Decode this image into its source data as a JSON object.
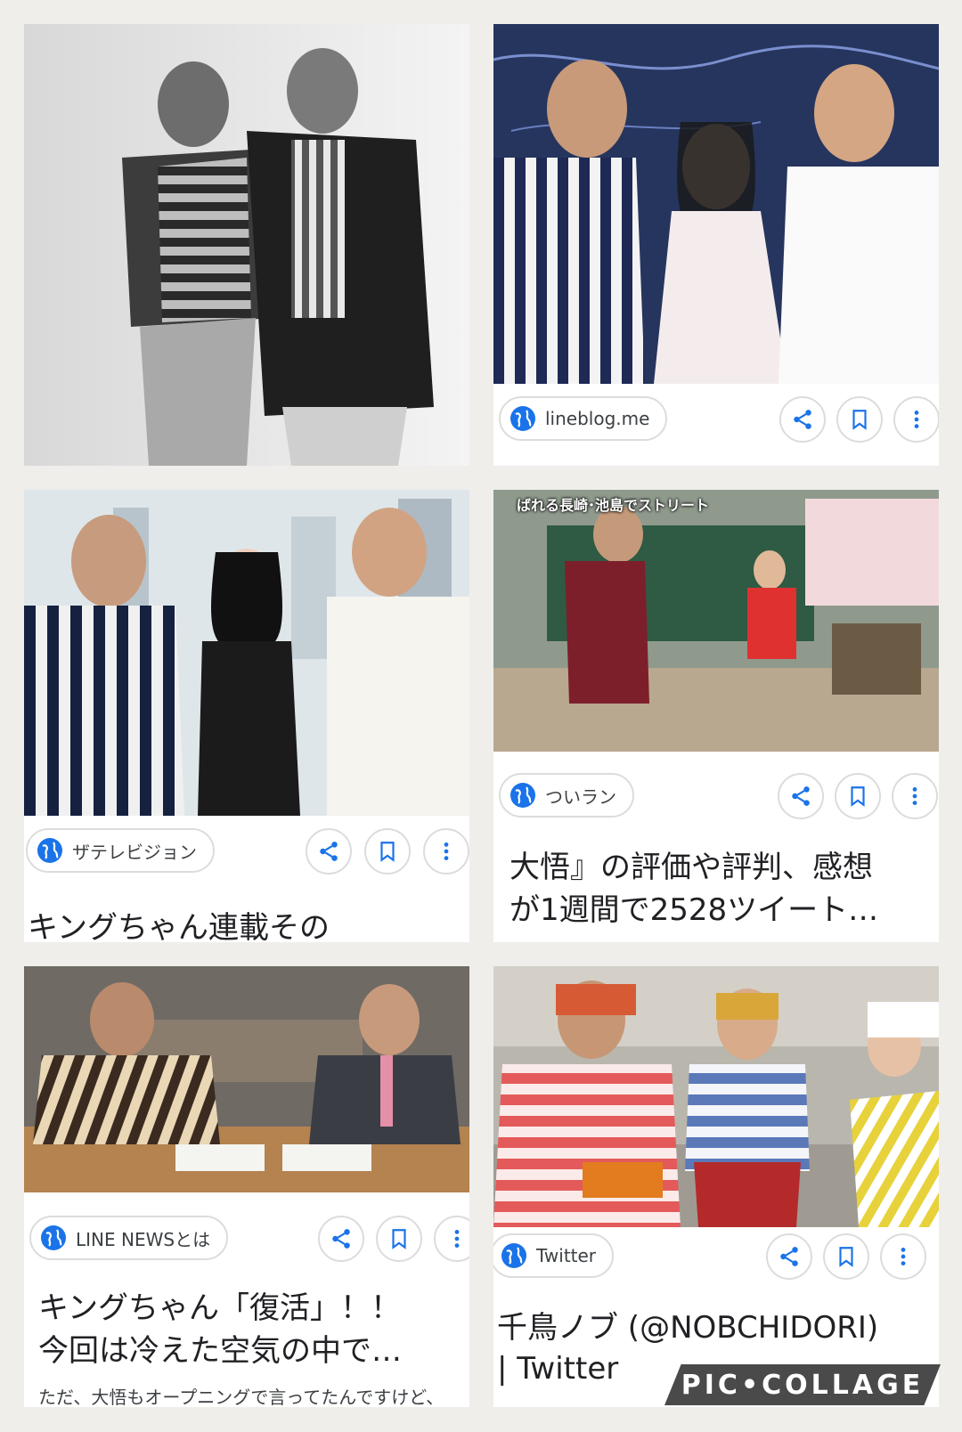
{
  "tiles": [
    {
      "id": "tile-1"
    },
    {
      "id": "tile-2",
      "source": "lineblog.me"
    },
    {
      "id": "tile-3",
      "source": "ザテレビジョン",
      "title_line1": "キングちゃん連載その"
    },
    {
      "id": "tile-4",
      "source": "ついラン",
      "title_line1": "大悟』の評価や評判、感想",
      "title_line2": "が1週間で2528ツイート…",
      "overlay_caption": "ばれる長崎･池島でストリート"
    },
    {
      "id": "tile-5",
      "source": "LINE NEWSとは",
      "title_line1": "キングちゃん「復活」！！",
      "title_line2": "今回は冷えた空気の中で…",
      "snippet": "ただ、大悟もオープニングで言ってたんですけど、"
    },
    {
      "id": "tile-6",
      "source": "Twitter",
      "title_line1": "千鳥ノブ (@NOBCHIDORI)",
      "title_line2": "| Twitter"
    }
  ],
  "icons": {
    "source": "globe-icon",
    "share": "share-icon",
    "save": "bookmark-icon",
    "more": "more-vert-icon"
  },
  "colors": {
    "background": "#efeeea",
    "accent": "#1a73e8",
    "text": "#202124"
  },
  "watermark": "PIC•COLLAGE"
}
